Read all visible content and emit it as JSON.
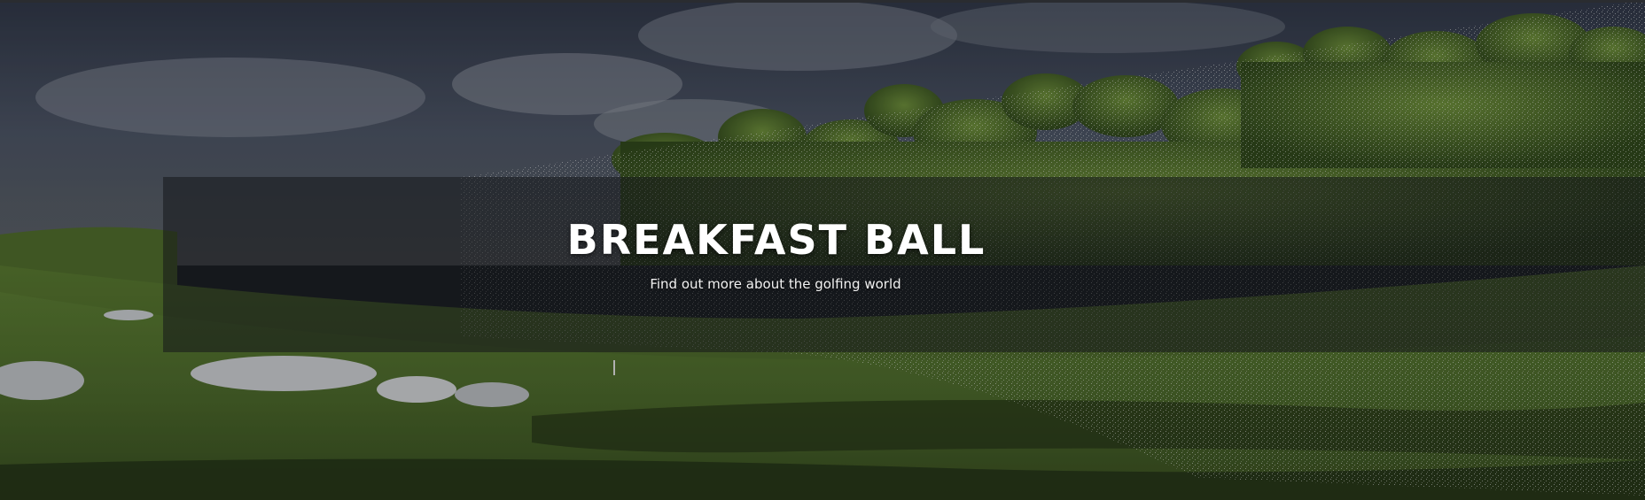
{
  "hero": {
    "title": "BREAKFAST BALL",
    "subtitle": "Find out more about the golfing world",
    "background_icon": "golf-course-landscape-image"
  },
  "colors": {
    "title_text": "#ffffff",
    "subtitle_text": "#f2f2f2",
    "overlay_box": "#14161a",
    "sky": "#3c4657",
    "fairway": "#4f6b2a",
    "trees": "#3f5a22"
  }
}
